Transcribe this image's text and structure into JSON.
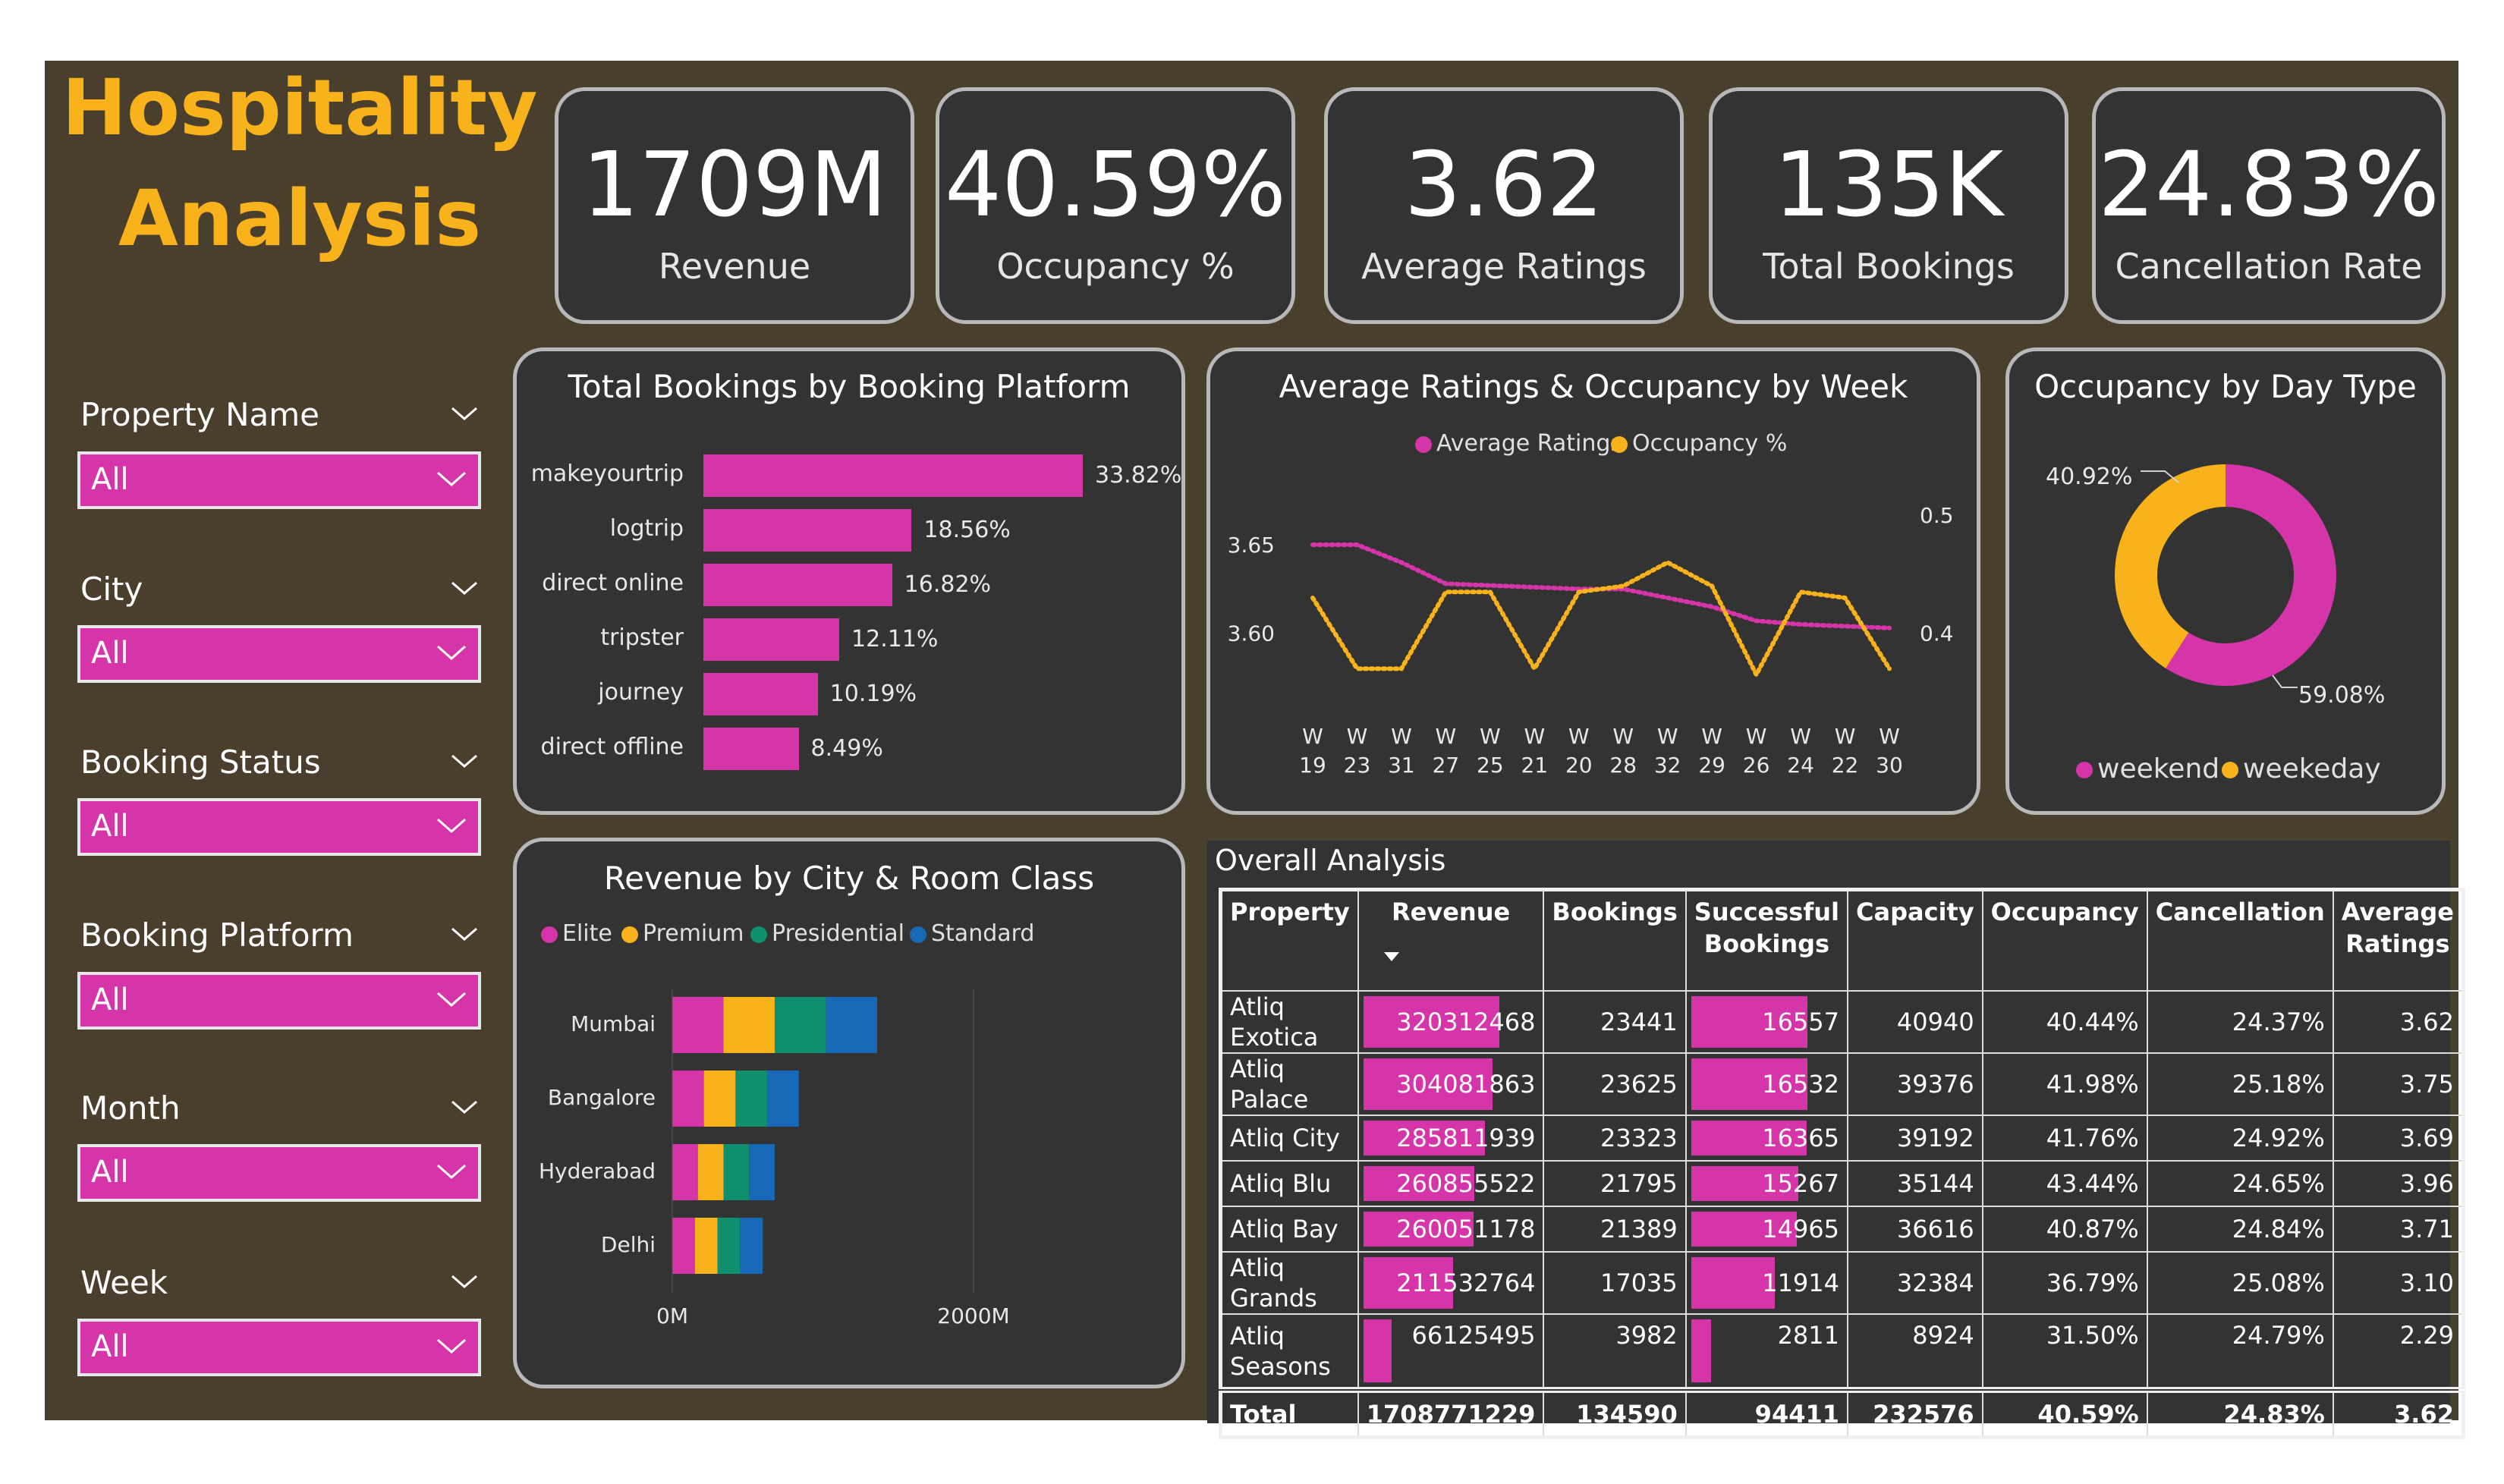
{
  "title": {
    "line1": "Hospitality",
    "line2": "Analysis"
  },
  "kpis": [
    {
      "value": "1709M",
      "label": "Revenue"
    },
    {
      "value": "40.59%",
      "label": "Occupancy %"
    },
    {
      "value": "3.62",
      "label": "Average Ratings"
    },
    {
      "value": "135K",
      "label": "Total Bookings"
    },
    {
      "value": "24.83%",
      "label": "Cancellation Rate"
    }
  ],
  "slicers": [
    {
      "label": "Property Name",
      "value": "All"
    },
    {
      "label": "City",
      "value": "All"
    },
    {
      "label": "Booking Status",
      "value": "All"
    },
    {
      "label": "Booking Platform",
      "value": "All"
    },
    {
      "label": "Month",
      "value": "All"
    },
    {
      "label": "Week",
      "value": "All"
    }
  ],
  "colors": {
    "accent": "#d535a8",
    "brand": "#f7b21c",
    "elite": "#d535a8",
    "premium": "#f7b21c",
    "presidential": "#0f8f6e",
    "standard": "#1868b8"
  },
  "chart_data": [
    {
      "type": "bar",
      "title": "Total Bookings by Booking Platform",
      "orientation": "horizontal",
      "categories": [
        "makeyourtrip",
        "logtrip",
        "direct online",
        "tripster",
        "journey",
        "direct offline"
      ],
      "values": [
        33.82,
        18.56,
        16.82,
        12.11,
        10.19,
        8.49
      ],
      "value_labels": [
        "33.82%",
        "18.56%",
        "16.82%",
        "12.11%",
        "10.19%",
        "8.49%"
      ]
    },
    {
      "type": "line",
      "title": "Average Ratings & Occupancy by Week",
      "legend": [
        "Average Ratings",
        "Occupancy %"
      ],
      "categories": [
        "W 19",
        "W 23",
        "W 31",
        "W 27",
        "W 25",
        "W 21",
        "W 20",
        "W 28",
        "W 32",
        "W 29",
        "W 26",
        "W 24",
        "W 22",
        "W 30"
      ],
      "x_ticks": [
        [
          "W",
          "19"
        ],
        [
          "W",
          "23"
        ],
        [
          "W",
          "31"
        ],
        [
          "W",
          "27"
        ],
        [
          "W",
          "25"
        ],
        [
          "W",
          "21"
        ],
        [
          "W",
          "20"
        ],
        [
          "W",
          "28"
        ],
        [
          "W",
          "32"
        ],
        [
          "W",
          "29"
        ],
        [
          "W",
          "26"
        ],
        [
          "W",
          "24"
        ],
        [
          "W",
          "22"
        ],
        [
          "W",
          "30"
        ]
      ],
      "series": [
        {
          "name": "Average Ratings",
          "axis": "left",
          "values": [
            3.65,
            3.65,
            3.64,
            3.628,
            3.627,
            3.626,
            3.625,
            3.625,
            3.62,
            3.615,
            3.607,
            3.605,
            3.604,
            3.603
          ]
        },
        {
          "name": "Occupancy %",
          "axis": "right",
          "values": [
            0.43,
            0.37,
            0.37,
            0.435,
            0.435,
            0.37,
            0.435,
            0.44,
            0.46,
            0.44,
            0.365,
            0.435,
            0.43,
            0.37
          ]
        }
      ],
      "y_left": {
        "ticks": [
          "3.65",
          "3.60"
        ],
        "tick_values": [
          3.65,
          3.6
        ],
        "range": [
          3.56,
          3.68
        ]
      },
      "y_right": {
        "ticks": [
          "0.5",
          "0.4"
        ],
        "tick_values": [
          0.5,
          0.4
        ],
        "range": [
          0.34,
          0.52
        ]
      }
    },
    {
      "type": "pie",
      "title": "Occupancy by Day Type",
      "categories": [
        "weekend",
        "weekeday"
      ],
      "values": [
        59.08,
        40.92
      ],
      "value_labels": [
        "59.08%",
        "40.92%"
      ]
    },
    {
      "type": "bar",
      "title": "Revenue by City & Room Class",
      "orientation": "horizontal",
      "stacked": true,
      "categories": [
        "Mumbai",
        "Bangalore",
        "Hyderabad",
        "Delhi"
      ],
      "series": [
        {
          "name": "Elite",
          "values": [
            340,
            210,
            170,
            150
          ]
        },
        {
          "name": "Premium",
          "values": [
            340,
            210,
            170,
            150
          ]
        },
        {
          "name": "Presidential",
          "values": [
            340,
            210,
            170,
            150
          ]
        },
        {
          "name": "Standard",
          "values": [
            340,
            210,
            170,
            150
          ]
        }
      ],
      "x_ticks": [
        "0M",
        "2000M"
      ],
      "x_tick_values": [
        0,
        2000
      ],
      "xlim": [
        0,
        2800
      ]
    }
  ],
  "table": {
    "title": "Overall Analysis",
    "columns": [
      [
        "Property"
      ],
      [
        "Revenue"
      ],
      [
        "Bookings"
      ],
      [
        "Successful",
        "Bookings"
      ],
      [
        "Capacity"
      ],
      [
        "Occupancy"
      ],
      [
        "Cancellation"
      ],
      [
        "Average",
        "Ratings"
      ]
    ],
    "rows": [
      {
        "property": "Atliq Exotica",
        "revenue": "320312468",
        "revenue_value": 320312468,
        "bookings": "23441",
        "successful": "16557",
        "successful_value": 16557,
        "capacity": "40940",
        "occupancy": "40.44%",
        "cancellation": "24.37%",
        "rating": "3.62"
      },
      {
        "property": "Atliq Palace",
        "revenue": "304081863",
        "revenue_value": 304081863,
        "bookings": "23625",
        "successful": "16532",
        "successful_value": 16532,
        "capacity": "39376",
        "occupancy": "41.98%",
        "cancellation": "25.18%",
        "rating": "3.75"
      },
      {
        "property": "Atliq City",
        "revenue": "285811939",
        "revenue_value": 285811939,
        "bookings": "23323",
        "successful": "16365",
        "successful_value": 16365,
        "capacity": "39192",
        "occupancy": "41.76%",
        "cancellation": "24.92%",
        "rating": "3.69"
      },
      {
        "property": "Atliq Blu",
        "revenue": "260855522",
        "revenue_value": 260855522,
        "bookings": "21795",
        "successful": "15267",
        "successful_value": 15267,
        "capacity": "35144",
        "occupancy": "43.44%",
        "cancellation": "24.65%",
        "rating": "3.96"
      },
      {
        "property": "Atliq Bay",
        "revenue": "260051178",
        "revenue_value": 260051178,
        "bookings": "21389",
        "successful": "14965",
        "successful_value": 14965,
        "capacity": "36616",
        "occupancy": "40.87%",
        "cancellation": "24.84%",
        "rating": "3.71"
      },
      {
        "property": "Atliq Grands",
        "revenue": "211532764",
        "revenue_value": 211532764,
        "bookings": "17035",
        "successful": "11914",
        "successful_value": 11914,
        "capacity": "32384",
        "occupancy": "36.79%",
        "cancellation": "25.08%",
        "rating": "3.10"
      },
      {
        "property": "Atliq Seasons",
        "revenue": "66125495",
        "revenue_value": 66125495,
        "bookings": "3982",
        "successful": "2811",
        "successful_value": 2811,
        "capacity": "8924",
        "occupancy": "31.50%",
        "cancellation": "24.79%",
        "rating": "2.29"
      }
    ],
    "total": {
      "label": "Total",
      "revenue": "1708771229",
      "bookings": "134590",
      "successful": "94411",
      "capacity": "232576",
      "occupancy": "40.59%",
      "cancellation": "24.83%",
      "rating": "3.62"
    }
  }
}
